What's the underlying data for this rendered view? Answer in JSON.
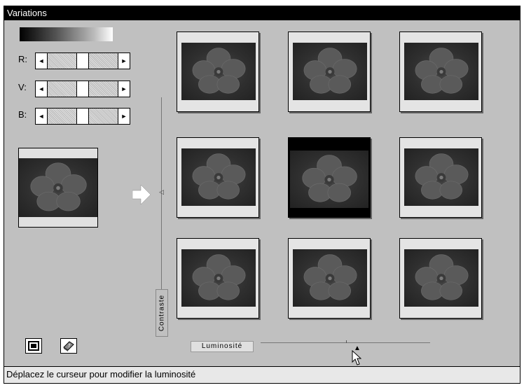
{
  "window": {
    "title": "Variations"
  },
  "rgb_sliders": [
    {
      "label": "R:",
      "level": 0.5
    },
    {
      "label": "V:",
      "level": 0.5
    },
    {
      "label": "B:",
      "level": 0.5
    }
  ],
  "contrast": {
    "label": "Contraste"
  },
  "luminosity": {
    "label": "Luminosité",
    "level": 0.55
  },
  "status": {
    "text": "Déplacez le curseur pour modifier la luminosité"
  },
  "icons": {
    "arrow_left": "◄",
    "arrow_right": "►",
    "marker_up": "▲",
    "marker_left": "◁",
    "toolbar": [
      "window-icon",
      "book-icon"
    ]
  },
  "colors": {
    "title_bg": "#000000",
    "panel_bg": "#c0c0c0",
    "selected_card": "#000000"
  }
}
